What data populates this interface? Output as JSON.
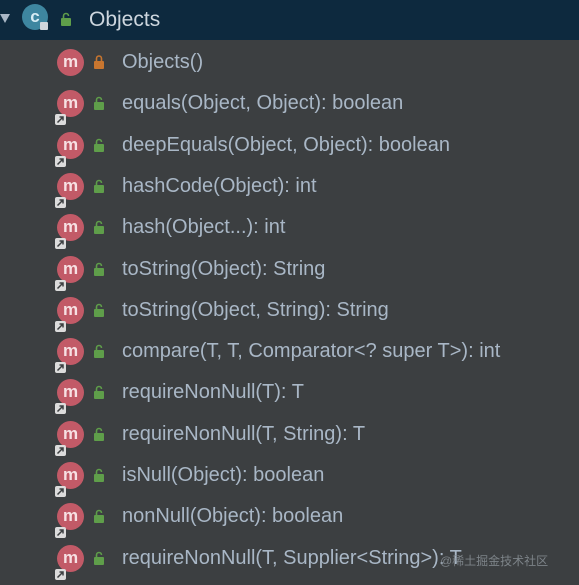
{
  "class_node": {
    "name": "Objects",
    "icon": "class-icon",
    "icon_letter": "c",
    "expanded": true
  },
  "members": [
    {
      "label": "Objects()",
      "access": "private",
      "inherited": false
    },
    {
      "label": "equals(Object, Object): boolean",
      "access": "public",
      "inherited": true
    },
    {
      "label": "deepEquals(Object, Object): boolean",
      "access": "public",
      "inherited": true
    },
    {
      "label": "hashCode(Object): int",
      "access": "public",
      "inherited": true
    },
    {
      "label": "hash(Object...): int",
      "access": "public",
      "inherited": true
    },
    {
      "label": "toString(Object): String",
      "access": "public",
      "inherited": true
    },
    {
      "label": "toString(Object, String): String",
      "access": "public",
      "inherited": true
    },
    {
      "label": "compare(T, T, Comparator<? super T>): int",
      "access": "public",
      "inherited": true
    },
    {
      "label": "requireNonNull(T): T",
      "access": "public",
      "inherited": true
    },
    {
      "label": "requireNonNull(T, String): T",
      "access": "public",
      "inherited": true
    },
    {
      "label": "isNull(Object): boolean",
      "access": "public",
      "inherited": true
    },
    {
      "label": "nonNull(Object): boolean",
      "access": "public",
      "inherited": true
    },
    {
      "label": "requireNonNull(T, Supplier<String>): T",
      "access": "public",
      "inherited": true
    }
  ],
  "method_icon_letter": "m",
  "watermark": "@稀土掘金技术社区",
  "colors": {
    "background": "#3c3f41",
    "selected_row": "#0d293e",
    "method_icon": "#c25a67",
    "class_icon": "#3e86a0",
    "public_access": "#5f9e4a",
    "private_access": "#c9762f",
    "text": "#a9b7c6"
  }
}
